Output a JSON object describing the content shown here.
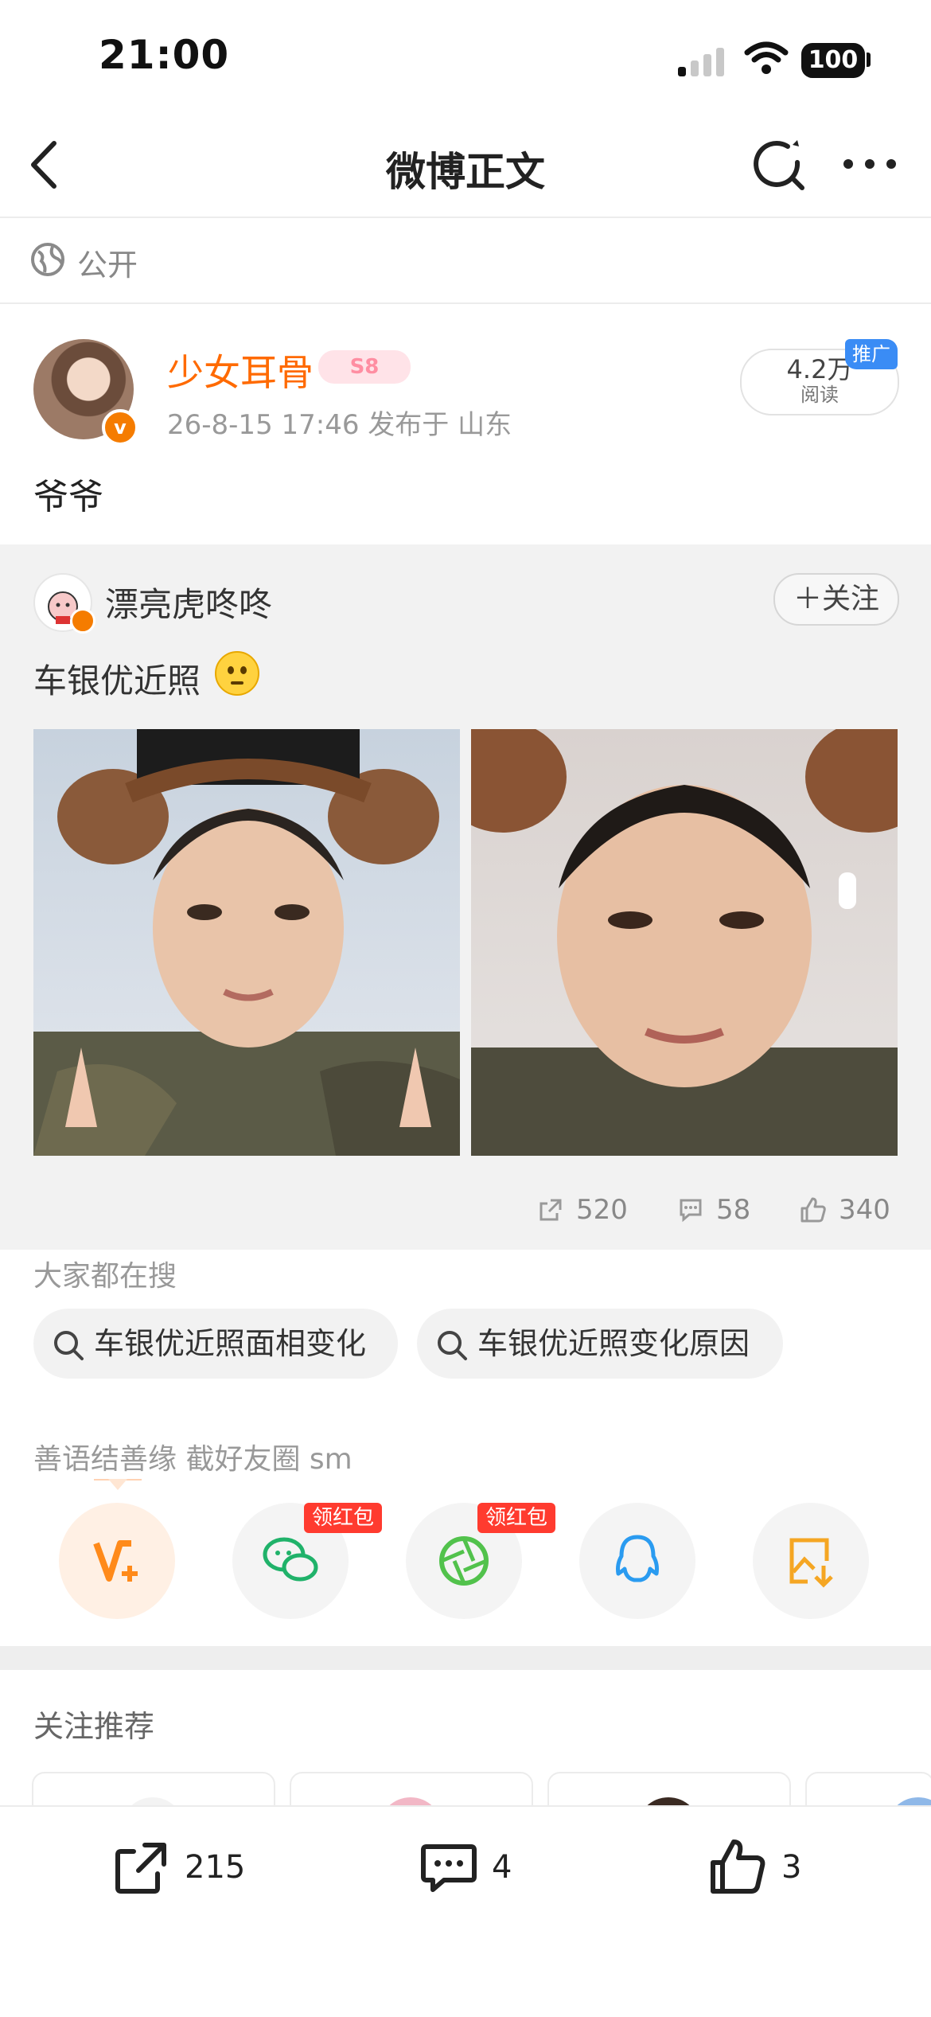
{
  "status_bar": {
    "time": "21:00",
    "battery": "100"
  },
  "nav": {
    "title": "微博正文"
  },
  "visibility": {
    "label": "公开"
  },
  "post": {
    "author": "少女耳骨",
    "level": "S8",
    "meta": "26-8-15 17:46   发布于 山东",
    "read_count": "4.2万",
    "read_label": "阅读",
    "promo": "推广",
    "text": "爷爷"
  },
  "repost": {
    "author": "漂亮虎咚咚",
    "follow": "＋关注",
    "text": "车银优近照",
    "stats": {
      "shares": "520",
      "comments": "58",
      "likes": "340"
    }
  },
  "searches": {
    "heading": "大家都在搜",
    "chips": [
      "车银优近照面相变化",
      "车银优近照变化原因"
    ]
  },
  "slogan": "善语结善缘 截好友圈 sm",
  "share": {
    "badges": [
      "领红包",
      "领红包"
    ]
  },
  "recommend": {
    "title": "关注推荐"
  },
  "bottom_bar": {
    "reposts": "215",
    "comments": "4",
    "likes": "3"
  }
}
